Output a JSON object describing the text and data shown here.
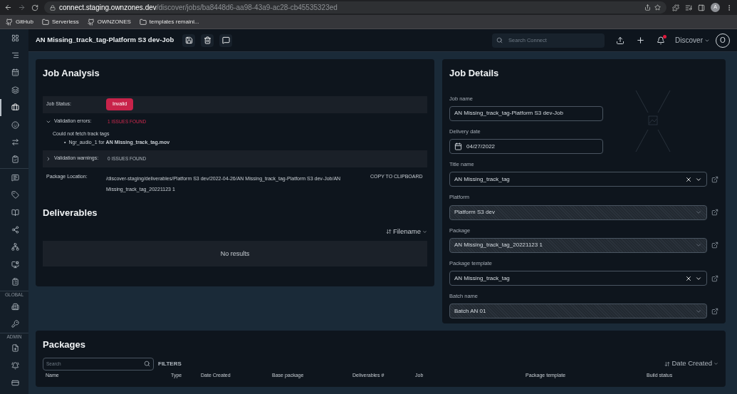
{
  "browser": {
    "url_host": "connect.staging.ownzones.dev",
    "url_path": "/discover/jobs/ba8448d6-aa98-43a9-ac28-cb45535323ed",
    "profile": "A",
    "bookmarks": [
      {
        "label": "GitHub",
        "kind": "github"
      },
      {
        "label": "Serverless",
        "kind": "folder"
      },
      {
        "label": "OWNZONES",
        "kind": "github"
      },
      {
        "label": "templates remaini...",
        "kind": "folder"
      }
    ]
  },
  "header": {
    "title": "AN Missing_track_tag-Platform S3 dev-Job",
    "search_placeholder": "Search Connect",
    "has_notification": true,
    "menu": "Discover",
    "avatar": "O"
  },
  "sidebar": {
    "groups": [
      {
        "items": [
          {
            "selected": false
          },
          {
            "selected": false
          },
          {
            "selected": false
          },
          {
            "selected": false
          },
          {
            "selected": true
          },
          {
            "selected": false
          },
          {
            "selected": false
          },
          {
            "selected": false
          }
        ]
      },
      {
        "items": [
          {
            "selected": false
          },
          {
            "selected": false
          },
          {
            "selected": false
          },
          {
            "selected": false
          },
          {
            "selected": false
          },
          {
            "selected": false
          },
          {
            "selected": false
          }
        ]
      },
      {
        "label": "GLOBAL",
        "items": [
          {
            "selected": false
          },
          {
            "selected": false
          }
        ]
      },
      {
        "label": "ADMIN",
        "items": [
          {
            "selected": false
          },
          {
            "selected": false
          },
          {
            "selected": false
          }
        ]
      }
    ]
  },
  "job_analysis": {
    "title": "Job Analysis",
    "status_label": "Job Status:",
    "status": "Invalid",
    "errors": {
      "label": "Validation errors:",
      "expanded": true,
      "count": "1 ISSUES FOUND",
      "message": "Could not fetch track tags",
      "bullet": "•",
      "detail": "Ngr_audio_1 for **AN Missing_track_tag.mov**"
    },
    "warnings": {
      "label": "Validation warnings:",
      "expanded": false,
      "count": "0 ISSUES FOUND"
    },
    "package_location": {
      "label": "Package Location:",
      "path": "/discover-staging/deliverables/Platform S3 dev/2022-04-26/AN Missing_track_tag-Platform S3 dev-Job/AN Missing_track_tag_20221123 1",
      "action": "COPY TO CLIPBOARD"
    }
  },
  "deliverables": {
    "title": "Deliverables",
    "sort": "Filename",
    "empty": "No results"
  },
  "job_details": {
    "title": "Job Details",
    "fields": [
      {
        "label": "Job name",
        "value": "AN Missing_track_tag-Platform S3 dev-Job",
        "kind": "text"
      },
      {
        "label": "Delivery date",
        "value": "04/27/2022",
        "kind": "date"
      },
      {
        "label": "Title name",
        "value": "AN Missing_track_tag",
        "kind": "select",
        "clearable": true,
        "disabled": false
      },
      {
        "label": "Platform",
        "value": "Platform S3 dev",
        "kind": "select",
        "clearable": false,
        "disabled": true
      },
      {
        "label": "Package",
        "value": "AN Missing_track_tag_20221123 1",
        "kind": "select",
        "clearable": false,
        "disabled": true
      },
      {
        "label": "Package template",
        "value": "AN Missing_track_tag",
        "kind": "select",
        "clearable": true,
        "disabled": false
      },
      {
        "label": "Batch name",
        "value": "Batch AN 01",
        "kind": "select",
        "clearable": false,
        "disabled": true
      }
    ]
  },
  "packages": {
    "title": "Packages",
    "search_placeholder": "Search",
    "filters": "FILTERS",
    "sort": "Date Created",
    "columns": [
      "Name",
      "Type",
      "Date Created",
      "Base package",
      "Deliverables #",
      "Job",
      "Package template",
      "Build status"
    ]
  }
}
